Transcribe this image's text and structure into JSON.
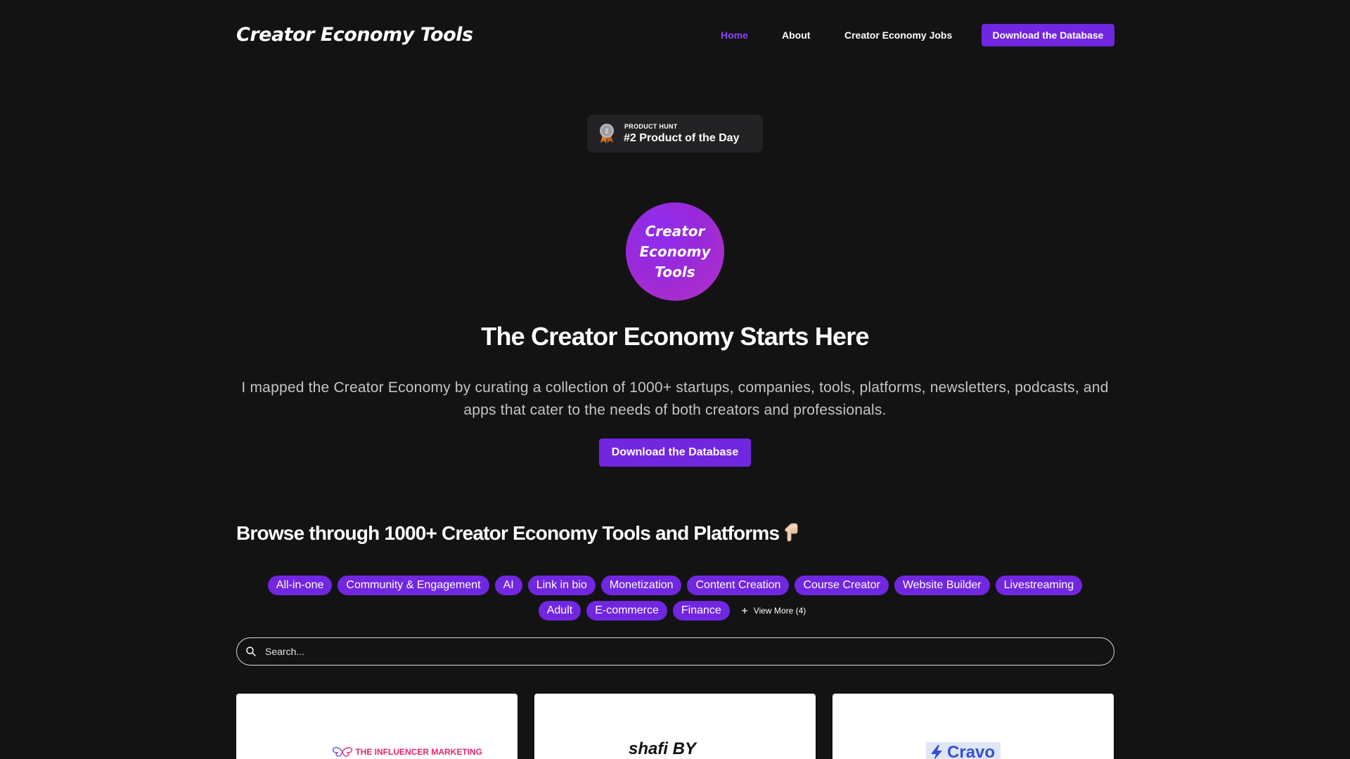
{
  "header": {
    "logo": "Creator Economy Tools",
    "nav": [
      {
        "label": "Home",
        "active": true
      },
      {
        "label": "About",
        "active": false
      },
      {
        "label": "Creator Economy Jobs",
        "active": false
      }
    ],
    "cta_label": "Download the Database"
  },
  "badge": {
    "medal_number": "2",
    "small_label": "PRODUCT HUNT",
    "title": "#2 Product of the Day"
  },
  "hero": {
    "logo_lines": [
      "Creator",
      "Economy",
      "Tools"
    ],
    "title": "The Creator Economy Starts Here",
    "description": "I mapped the Creator Economy by curating a collection of 1000+ startups, companies, tools, platforms, newsletters, podcasts, and apps that cater to the needs of both creators and professionals.",
    "cta_label": "Download the Database"
  },
  "browse": {
    "title": "Browse through 1000+ Creator Economy Tools and Platforms",
    "pointer_icon": "backhand-index-pointing-down",
    "tags_row1": [
      "All-in-one",
      "Community & Engagement",
      "AI",
      "Link in bio",
      "Monetization",
      "Content Creation",
      "Course Creator",
      "Website Builder",
      "Livestreaming"
    ],
    "tags_row2": [
      "Adult",
      "E-commerce",
      "Finance"
    ],
    "view_more_label": "View More (4)"
  },
  "search": {
    "placeholder": "Search..."
  },
  "cards": [
    {
      "logo_text": "THE INFLUENCER MARKETING"
    },
    {
      "logo_text": "shafi BY"
    },
    {
      "logo_text": "Cravo"
    }
  ],
  "colors": {
    "background": "#131314",
    "accent": "#7126e0",
    "active_nav": "#8b45f3"
  }
}
